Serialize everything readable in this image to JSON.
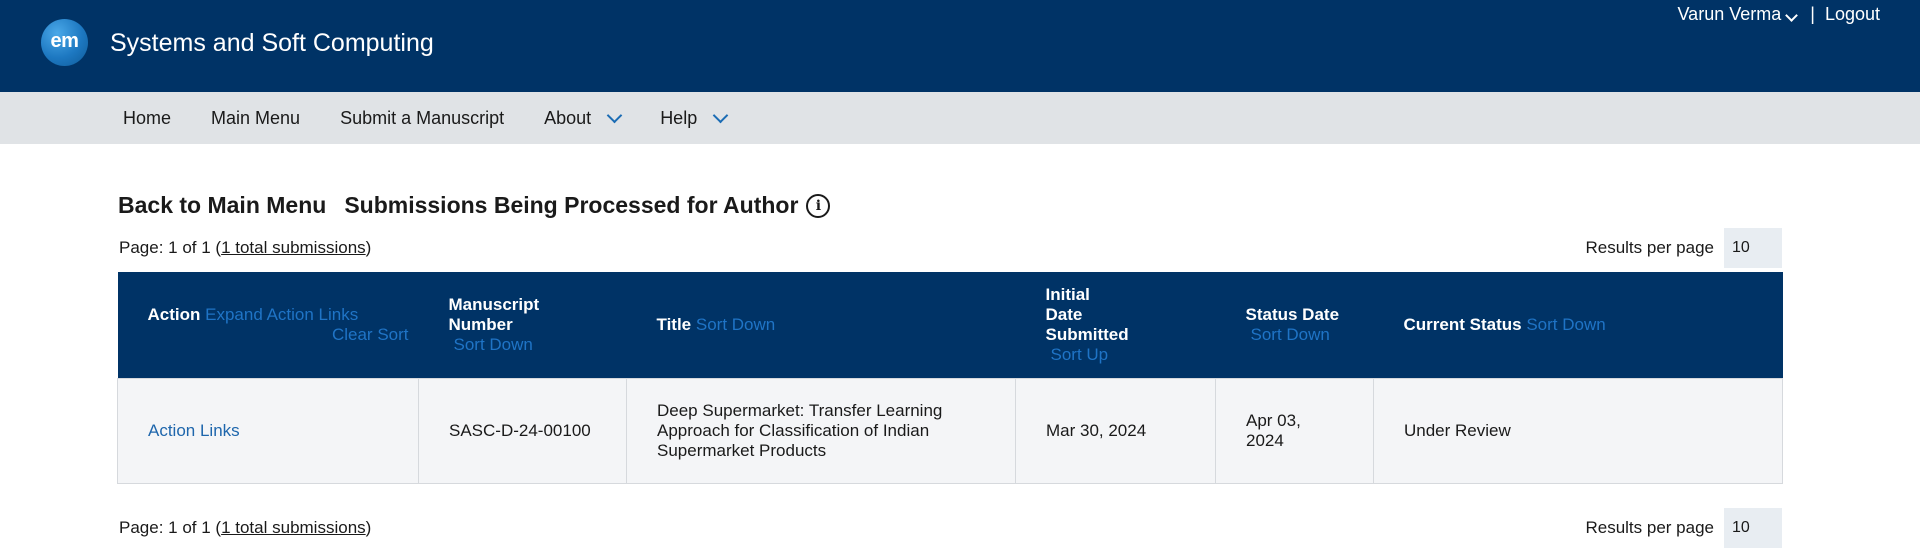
{
  "header": {
    "logo_text": "em",
    "journal_title": "Systems and Soft Computing",
    "user_name": "Varun Verma",
    "separator": "|",
    "logout_label": "Logout",
    "bg_color": "#003366"
  },
  "nav": {
    "items": [
      {
        "label": "Home"
      },
      {
        "label": "Main Menu"
      },
      {
        "label": "Submit a Manuscript"
      },
      {
        "label": "About"
      },
      {
        "label": "Help"
      }
    ]
  },
  "page": {
    "back_link": "Back to Main Menu",
    "title": "Submissions Being Processed for Author",
    "info_icon": "i"
  },
  "pager_top": {
    "text_prefix": "Page: 1 of 1 (",
    "total_link": "1 total submissions",
    "text_suffix": ")",
    "rpp_label": "Results per page",
    "rpp_value": "10"
  },
  "pager_bottom": {
    "text_prefix": "Page: 1 of 1 (",
    "total_link": "1 total submissions",
    "text_suffix": ")",
    "rpp_label": "Results per page",
    "rpp_value": "10"
  },
  "table": {
    "headers": {
      "action": "Action",
      "expand": "Expand Action Links",
      "clear_sort": "Clear Sort",
      "manuscript": "Manuscript Number",
      "manuscript_sort": "Sort Down",
      "title": "Title",
      "title_sort": "Sort Down",
      "initial_date": "Initial Date Submitted",
      "initial_date_sort": "Sort Up",
      "status_date": "Status Date",
      "status_date_sort": "Sort Down",
      "current_status": "Current Status",
      "current_status_sort": "Sort Down"
    },
    "rows": [
      {
        "action": "Action Links",
        "manuscript_number": "SASC-D-24-00100",
        "title": "Deep Supermarket: Transfer Learning Approach for Classification of Indian Supermarket Products",
        "initial_date": "Mar 30, 2024",
        "status_date": "Apr 03, 2024",
        "current_status": "Under Review"
      }
    ]
  }
}
